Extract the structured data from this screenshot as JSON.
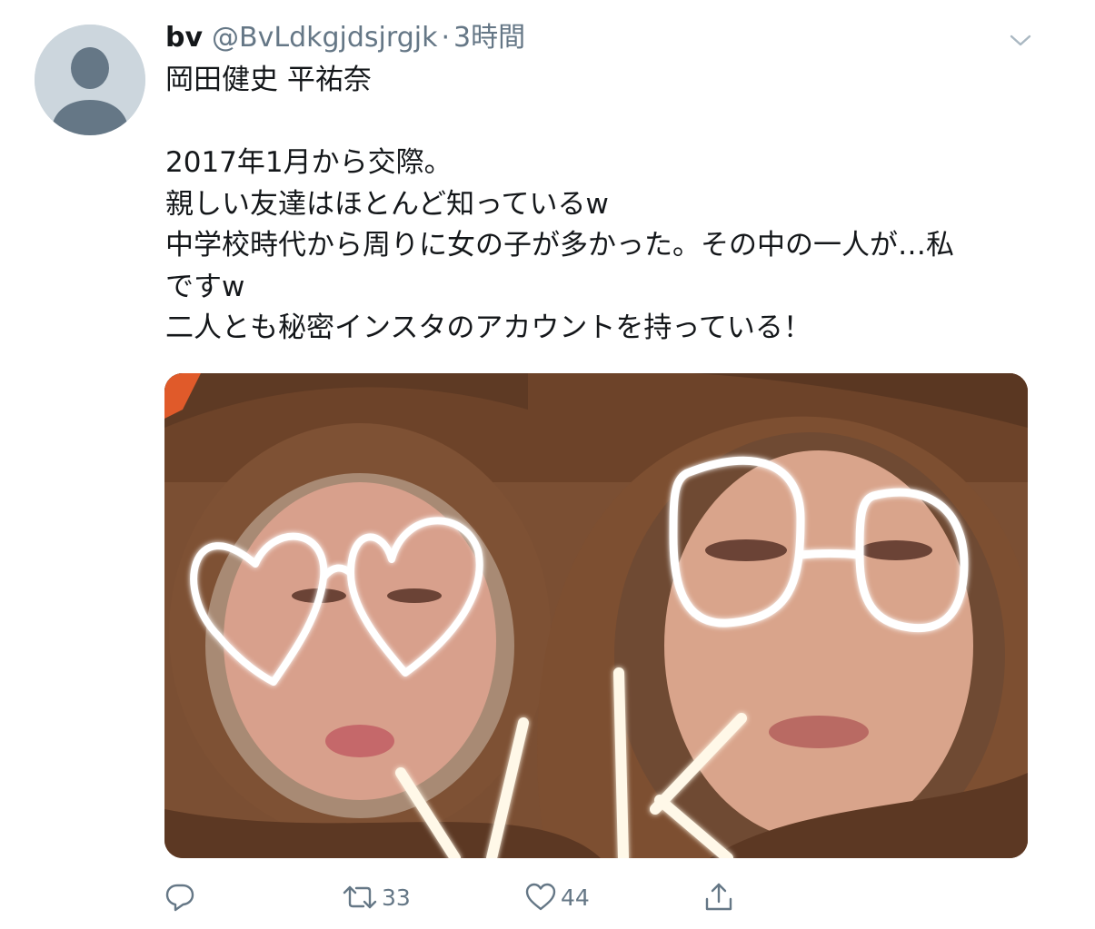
{
  "tweet": {
    "display_name": "bv",
    "handle": "@BvLdkgjdsjrgjk",
    "separator": "·",
    "timestamp": "3時間",
    "text_lines": [
      "岡田健史 平祐奈",
      "",
      "2017年1月から交際。",
      "親しい友達はほとんど知っているw",
      "中学校時代から周りに女の子が多かった。その中の一人が…私",
      "ですw",
      "二人とも秘密インスタのアカウントを持っている！"
    ],
    "photo": {
      "overlay_text": "YK"
    }
  },
  "actions": {
    "reply_icon": "reply-icon",
    "retweet_icon": "retweet-icon",
    "retweet_count": "33",
    "like_icon": "heart-icon",
    "like_count": "44",
    "share_icon": "share-icon"
  },
  "colors": {
    "text_primary": "#14171a",
    "text_secondary": "#657786",
    "avatar_bg": "#ccd6dd",
    "avatar_figure": "#657786"
  }
}
